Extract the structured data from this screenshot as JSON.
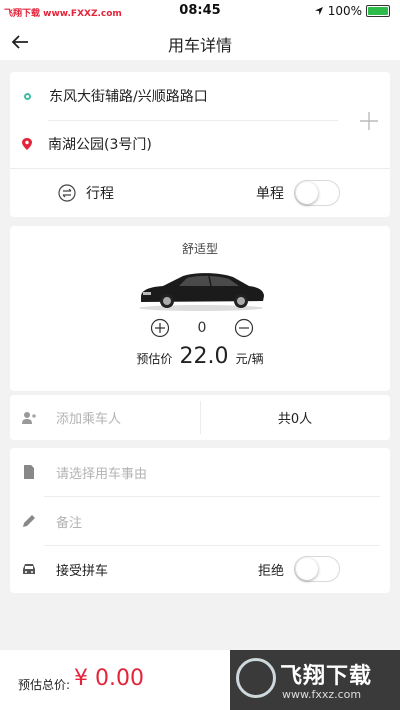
{
  "status_bar": {
    "watermark": "飞翔下载 www.FXXZ.com",
    "time": "08:45",
    "battery_text": "100%",
    "battery_level": 1.0
  },
  "nav": {
    "title": "用车详情",
    "back_icon": "arrow-left-icon"
  },
  "route": {
    "start": "东风大街辅路/兴顺路路口",
    "end": "南湖公园(3号门)",
    "trip_label": "行程",
    "one_way_label": "单程",
    "one_way_on": false
  },
  "car": {
    "type": "舒适型",
    "quantity": "0",
    "price_label": "预估价",
    "price": "22.0",
    "price_unit": "元/辆"
  },
  "passenger": {
    "placeholder": "添加乘车人",
    "count_text": "共0人"
  },
  "form": {
    "reason_placeholder": "请选择用车事由",
    "note_placeholder": "备注",
    "carpool_label": "接受拼车",
    "reject_label": "拒绝",
    "carpool_on": false
  },
  "footer": {
    "total_label": "预估总价:",
    "total_value": "¥ 0.00",
    "watermark_big": "飞翔下载",
    "watermark_small": "www.fxxz.com"
  },
  "colors": {
    "accent_red": "#e5243b",
    "start_dot": "#3fbf9f",
    "battery_green": "#2dbb4a"
  }
}
